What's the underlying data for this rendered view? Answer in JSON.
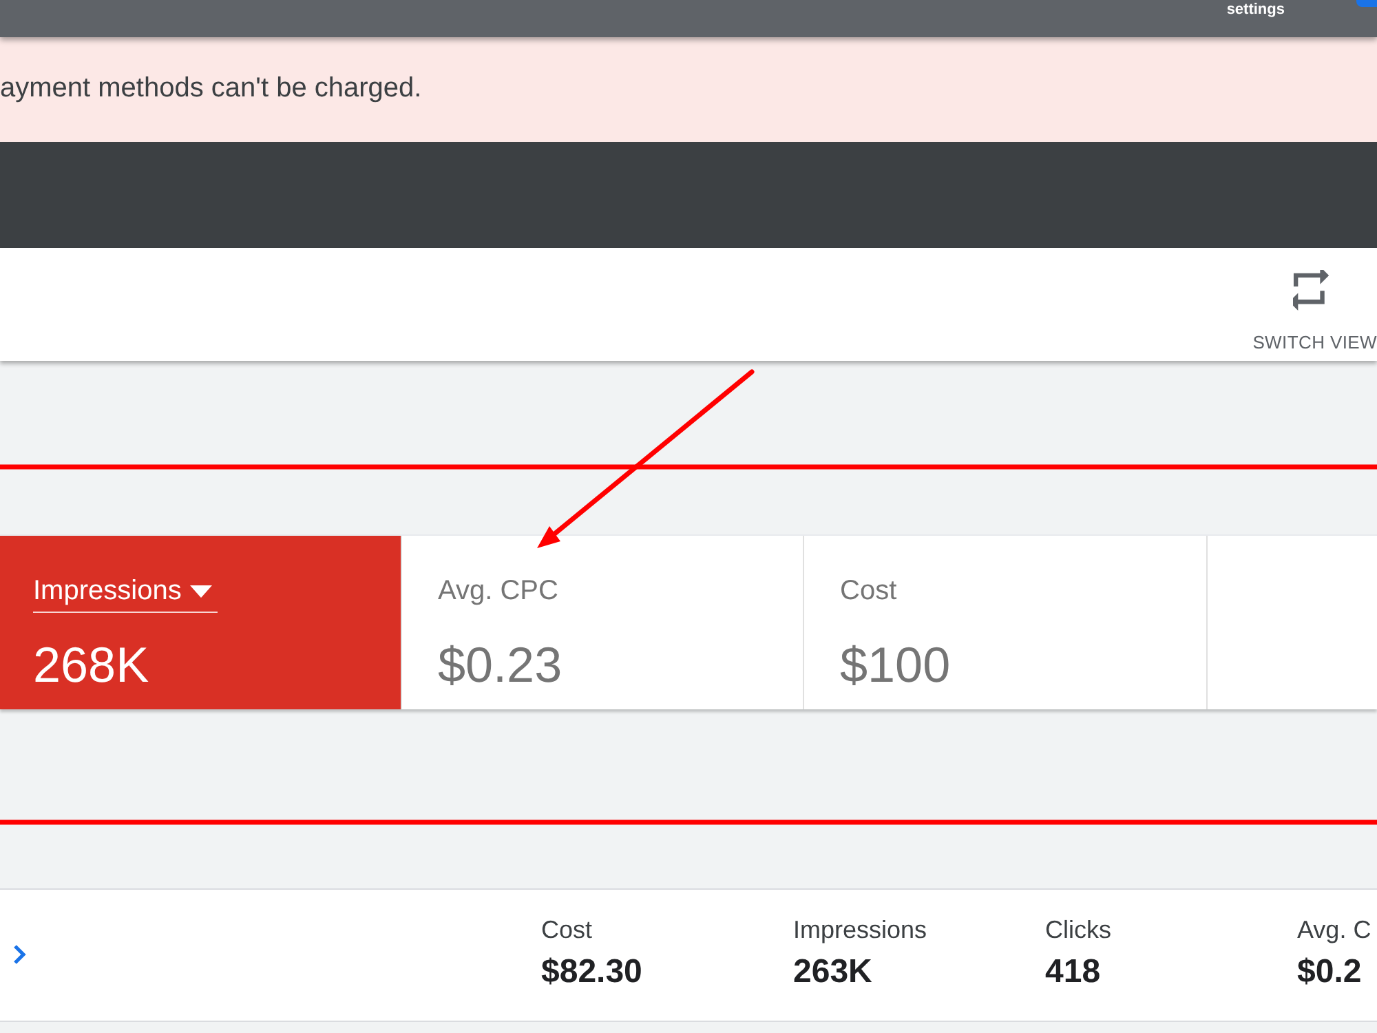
{
  "top_bar": {
    "settings_label": "settings"
  },
  "alert": {
    "message": "ayment methods can't be charged."
  },
  "toolbar": {
    "switch_view_label": "SWITCH VIEW"
  },
  "scorecards": [
    {
      "label": "Impressions",
      "value": "268K",
      "selected": true
    },
    {
      "label": "Avg. CPC",
      "value": "$0.23",
      "selected": false
    },
    {
      "label": "Cost",
      "value": "$100",
      "selected": false
    },
    {
      "selected": false
    }
  ],
  "summary_row": {
    "columns": [
      {
        "label": "Cost",
        "value": "$82.30"
      },
      {
        "label": "Impressions",
        "value": "263K"
      },
      {
        "label": "Clicks",
        "value": "418"
      },
      {
        "label": "Avg. C",
        "value": "$0.2"
      }
    ]
  }
}
